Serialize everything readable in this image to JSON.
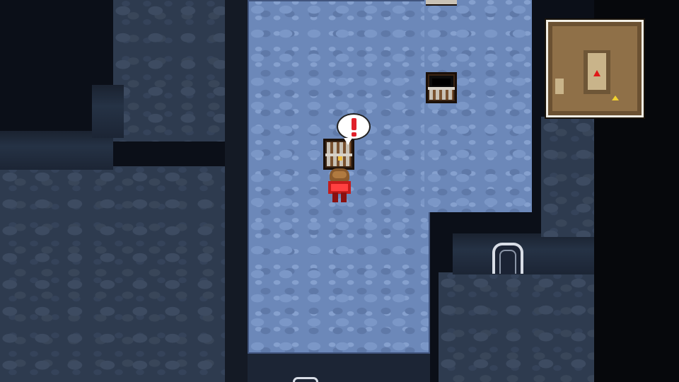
{
  "game": {
    "scene": "dungeon-cave",
    "icons": {
      "exclamation": "exclamation-icon",
      "player_marker": "player-arrow-icon",
      "exit_marker": "exit-triangle-icon"
    },
    "colors": {
      "lit_floor": "#6c88b9",
      "dark_floor": "#2e3b4f",
      "hero_red": "#c41c1c",
      "alert_red": "#e0202a",
      "minimap_parchment": "#8f7048"
    },
    "chests": [
      {
        "state": "opened"
      },
      {
        "state": "closed"
      },
      {
        "state": "partial"
      }
    ],
    "alert": "!"
  }
}
